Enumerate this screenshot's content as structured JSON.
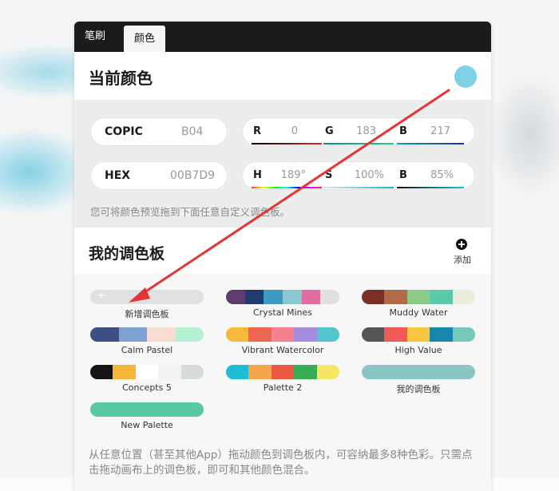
{
  "tabs": [
    {
      "label": "笔刷"
    },
    {
      "label": "颜色"
    }
  ],
  "current": {
    "title": "当前颜色",
    "swatch_color": "#7fd1e8"
  },
  "copic": {
    "label": "COPIC",
    "value": "B04"
  },
  "hex": {
    "label": "HEX",
    "value": "00B7D9"
  },
  "rgb": {
    "r_label": "R",
    "r_value": "0",
    "g_label": "G",
    "g_value": "183",
    "b_label": "B",
    "b_value": "217"
  },
  "hsb": {
    "h_label": "H",
    "h_value": "189°",
    "s_label": "S",
    "s_value": "100%",
    "b_label": "B",
    "b_value": "85%"
  },
  "hint": "您可将颜色预览拖到下面任意自定义调色板。",
  "palette_section": {
    "title": "我的调色板",
    "add_label": "添加"
  },
  "palettes": [
    {
      "name": "新增调色板",
      "colors": [
        "#dfe1e2"
      ],
      "is_new": true,
      "icon": "plus-icon"
    },
    {
      "name": "Crystal Mines",
      "colors": [
        "#5e3d6e",
        "#1f3b70",
        "#3d9ac5",
        "#8bc8cf",
        "#e06fa0",
        "#e0e0e0"
      ]
    },
    {
      "name": "Muddy Water",
      "colors": [
        "#7a2e24",
        "#b06a45",
        "#8ecb8a",
        "#5cc9a8",
        "#e9eedb"
      ]
    },
    {
      "name": "Calm Pastel",
      "colors": [
        "#3d4f84",
        "#7ea2d3",
        "#f7dcd1",
        "#b6f0d5"
      ]
    },
    {
      "name": "Vibrant Watercolor",
      "colors": [
        "#f6b93b",
        "#ee6652",
        "#f5808e",
        "#a58cdd",
        "#55c4cf"
      ]
    },
    {
      "name": "High Value",
      "colors": [
        "#555555",
        "#f25a57",
        "#f8c640",
        "#1b86ab",
        "#77c9b7"
      ]
    },
    {
      "name": "Concepts 5",
      "colors": [
        "#141414",
        "#f5b73b",
        "#ffffff",
        "#f2f2f2",
        "#d8dbdc"
      ]
    },
    {
      "name": "Palette 2",
      "colors": [
        "#1fbcd6",
        "#f6a64b",
        "#ec5a45",
        "#37ad56",
        "#f7e665"
      ]
    },
    {
      "name": "我的调色板",
      "colors": [
        "#8bc6c5"
      ]
    },
    {
      "name": "New Palette",
      "colors": [
        "#58c9a3"
      ]
    }
  ],
  "footer": "从任意位置（甚至其他App）拖动颜色到调色板内，可容纳最多8种色彩。只需点击拖动画布上的调色板，即可和其他颜色混合。",
  "annotation_color": "#e3343a"
}
